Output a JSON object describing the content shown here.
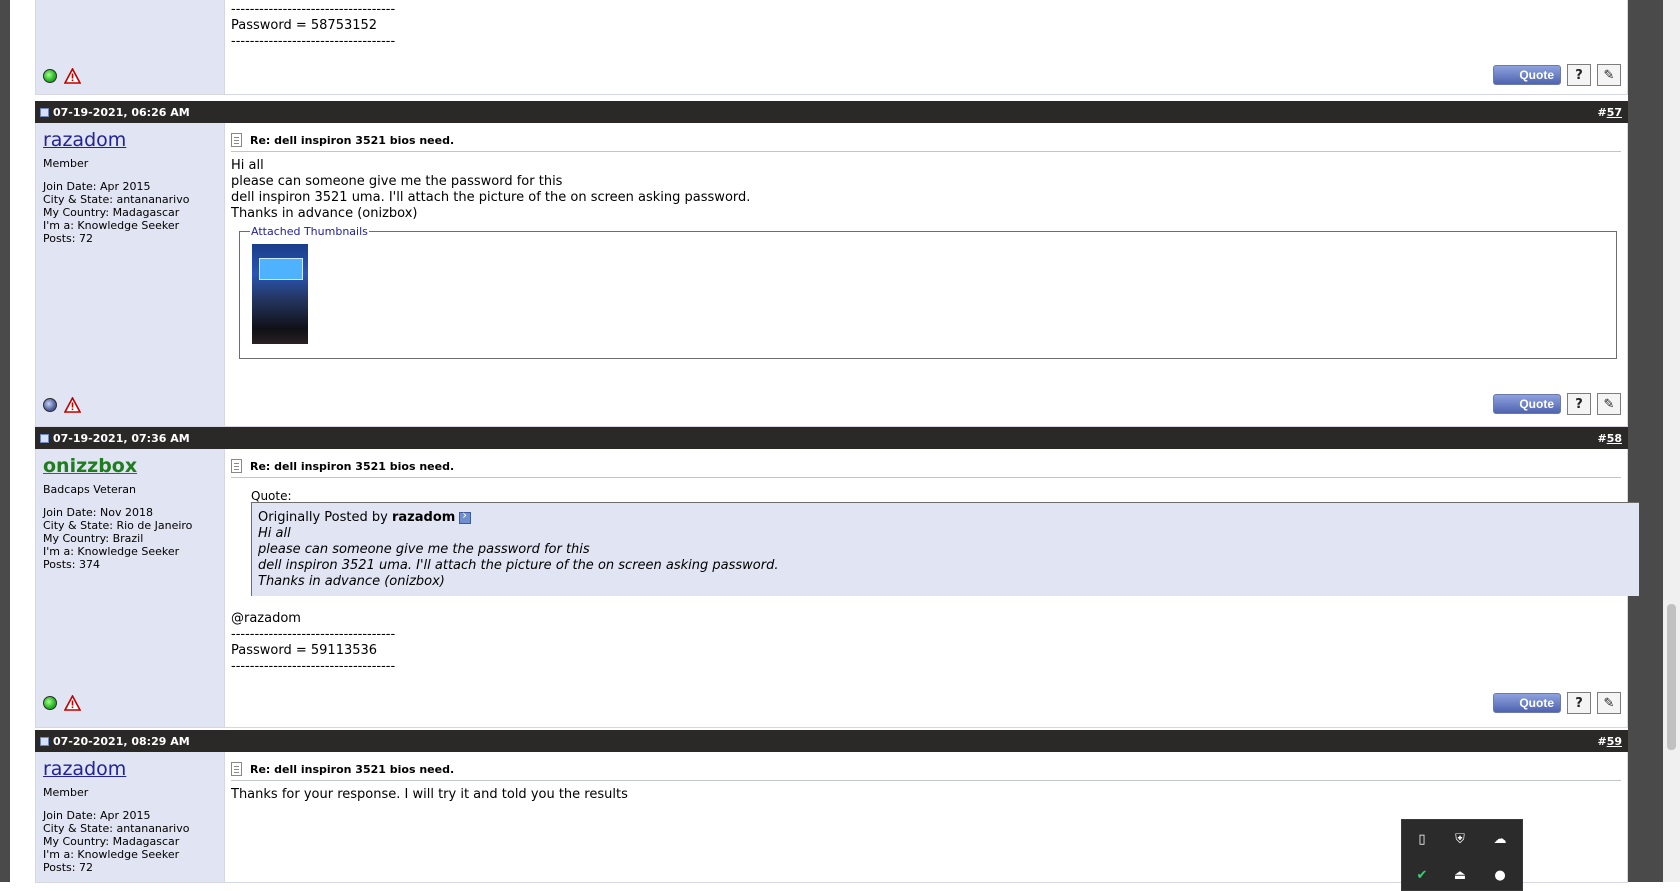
{
  "posts": [
    {
      "id": "p56",
      "content_lines": [
        "-----------------------------------",
        "Password = 58753152",
        "-----------------------------------"
      ],
      "user_status": "online",
      "buttons": {
        "quote": "Quote",
        "multiquote": "?",
        "edit": "✎"
      }
    },
    {
      "id": "p57",
      "date": "07-19-2021, 06:26 AM",
      "number_prefix": "#",
      "number": "57",
      "username": "razadom",
      "user_title": "Member",
      "details": {
        "join_date": "Join Date: Apr 2015",
        "city": "City & State: antananarivo",
        "country": "My Country: Madagascar",
        "im_a": "I'm a: Knowledge Seeker",
        "posts": "Posts: 72"
      },
      "title": "Re: dell inspiron 3521 bios need.",
      "message": "Hi all\nplease can someone give me the password for this\ndell inspiron 3521 uma. I'll attach the picture of the on screen asking password.\nThanks in advance (onizbox)",
      "attachments_label": "Attached Thumbnails",
      "user_status": "offline",
      "buttons": {
        "quote": "Quote",
        "multiquote": "?",
        "edit": "✎"
      }
    },
    {
      "id": "p58",
      "date": "07-19-2021, 07:36 AM",
      "number_prefix": "#",
      "number": "58",
      "username": "onizzbox",
      "user_title": "Badcaps Veteran",
      "details": {
        "join_date": "Join Date: Nov 2018",
        "city": "City & State: Rio de Janeiro",
        "country": "My Country: Brazil",
        "im_a": "I'm a: Knowledge Seeker",
        "posts": "Posts: 374"
      },
      "title": "Re: dell inspiron 3521 bios need.",
      "quote_label": "Quote:",
      "quote_prefix": "Originally Posted by",
      "quote_author": "razadom",
      "quote_text": "Hi all\nplease can someone give me the password for this\ndell inspiron 3521 uma. I'll attach the picture of the on screen asking password.\nThanks in advance (onizbox)",
      "message": "@razadom\n-----------------------------------\nPassword = 59113536\n-----------------------------------",
      "user_status": "online",
      "buttons": {
        "quote": "Quote",
        "multiquote": "?",
        "edit": "✎"
      }
    },
    {
      "id": "p59",
      "date": "07-20-2021, 08:29 AM",
      "number_prefix": "#",
      "number": "59",
      "username": "razadom",
      "user_title": "Member",
      "details": {
        "join_date": "Join Date: Apr 2015",
        "city": "City & State: antananarivo",
        "country": "My Country: Madagascar",
        "im_a": "I'm a: Knowledge Seeker",
        "posts": "Posts: 72"
      },
      "title": "Re: dell inspiron 3521 bios need.",
      "message": "Thanks for your response. I will try it and told you the results"
    }
  ],
  "colors": {
    "header_bg": "#2b2828",
    "userinfo_bg": "#e1e4f2",
    "username_link": "#22229c",
    "username_veteran": "#1e7d1e"
  },
  "tray_icons": [
    "usb-icon",
    "defender-shield-icon",
    "cloud-offline-icon",
    "check-icon",
    "usb-eject-icon",
    "tray-app-icon"
  ]
}
